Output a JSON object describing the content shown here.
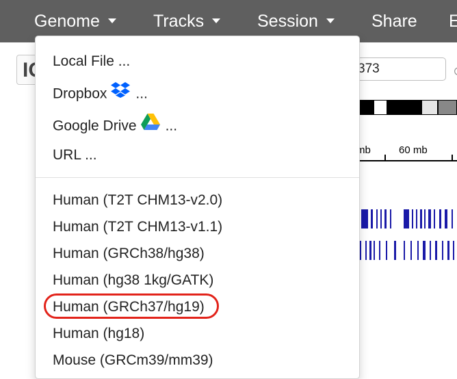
{
  "navbar": {
    "items": [
      {
        "label": "Genome"
      },
      {
        "label": "Tracks"
      },
      {
        "label": "Session"
      },
      {
        "label": "Share"
      },
      {
        "label": "E"
      }
    ]
  },
  "background": {
    "logo_text": "IG",
    "locus_value": "373",
    "ruler_labels": [
      "mb",
      "60 mb"
    ]
  },
  "genome_menu": {
    "load_items": [
      {
        "label": "Local File ...",
        "icon": null,
        "suffix": ""
      },
      {
        "label": "Dropbox",
        "icon": "dropbox-icon",
        "suffix": "..."
      },
      {
        "label": "Google Drive",
        "icon": "google-drive-icon",
        "suffix": "..."
      },
      {
        "label": "URL ...",
        "icon": null,
        "suffix": ""
      }
    ],
    "genomes": [
      {
        "label": "Human (T2T CHM13-v2.0)"
      },
      {
        "label": "Human (T2T CHM13-v1.1)"
      },
      {
        "label": "Human (GRCh38/hg38)"
      },
      {
        "label": "Human (hg38 1kg/GATK)"
      },
      {
        "label": "Human (GRCh37/hg19)"
      },
      {
        "label": "Human (hg18)"
      },
      {
        "label": "Mouse (GRCm39/mm39)"
      }
    ],
    "highlighted": "Human (GRCh37/hg19)",
    "highlight_color": "#e2231a"
  },
  "colors": {
    "navbar_bg": "#5f5f5f",
    "gene_feature": "#1a1aa8"
  }
}
